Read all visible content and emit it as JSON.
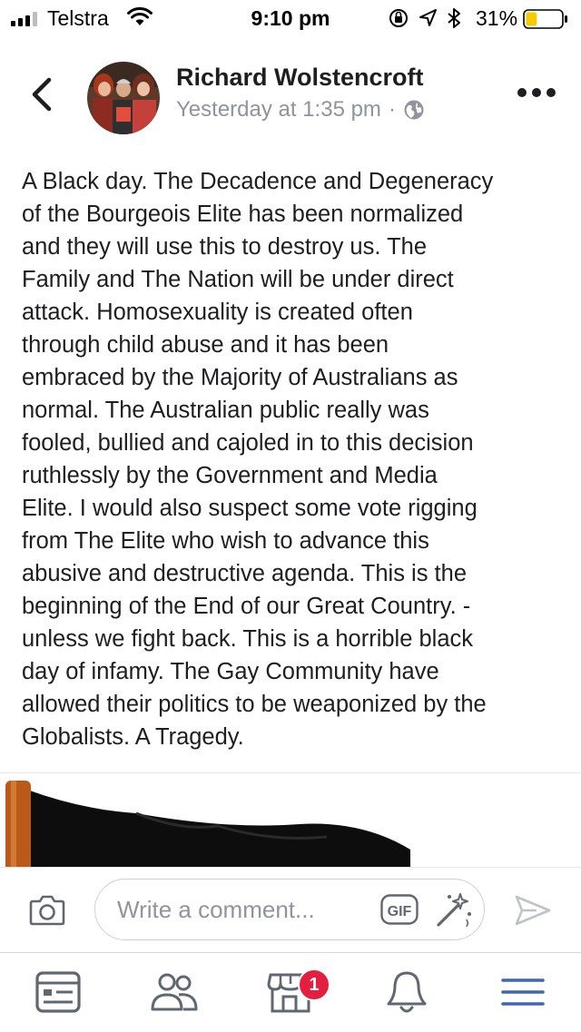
{
  "status_bar": {
    "carrier": "Telstra",
    "time": "9:10 pm",
    "battery_percent": "31%",
    "battery_level": 0.31,
    "battery_color": "#f5cc00"
  },
  "post": {
    "author": "Richard Wolstencroft",
    "timestamp": "Yesterday at 1:35 pm",
    "separator": "·",
    "privacy_icon": "globe-icon",
    "text": "A Black day. The Decadence and Degeneracy\nof the Bourgeois Elite has been normalized\nand they will use this to destroy us. The\nFamily and The Nation will be under direct\nattack. Homosexuality is created often\nthrough child abuse and it has been\nembraced by the Majority of Australians as\nnormal. The Australian public really was\nfooled, bullied and cajoled in to this decision\nruthlessly by the Government and Media\nElite. I would also suspect some vote rigging\nfrom The Elite who wish to advance this\nabusive and destructive agenda. This is the\nbeginning of the End of our Great Country. -\nunless we fight back. This is a  horrible black\nday of infamy. The Gay Community have\nallowed their politics to be weaponized by the\nGlobalists. A Tragedy."
  },
  "comment_bar": {
    "placeholder": "Write a comment...",
    "gif_label": "GIF"
  },
  "tab_bar": {
    "items": [
      "news-feed-icon",
      "friends-icon",
      "marketplace-icon",
      "notifications-icon",
      "menu-icon"
    ],
    "marketplace_badge": "1",
    "accent": "#4267b2"
  }
}
